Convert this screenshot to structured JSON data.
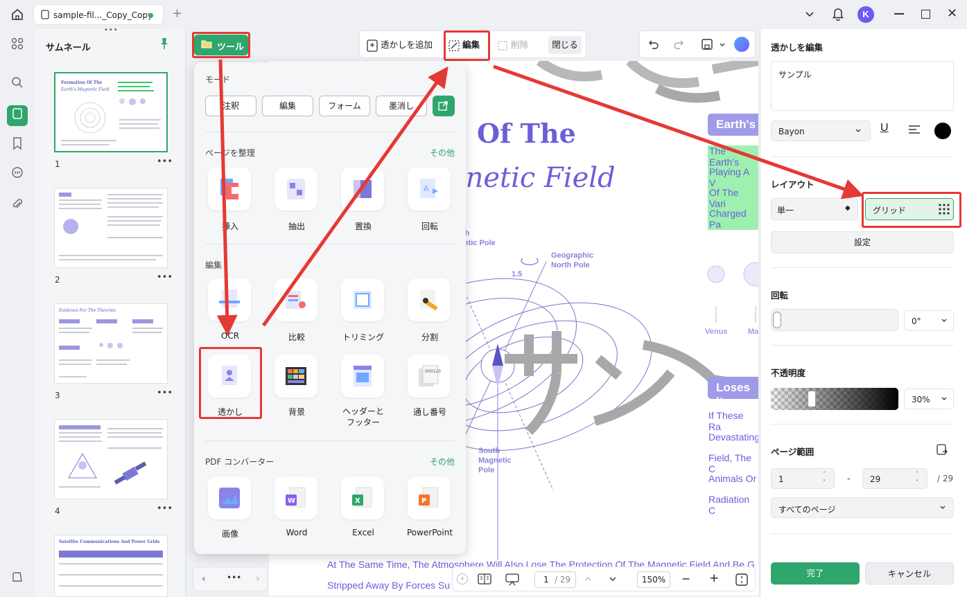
{
  "titlebar": {
    "tab_label": "sample-fil..._Copy_Copy",
    "avatar_letter": "K"
  },
  "thumbnails": {
    "title": "サムネール",
    "pages": [
      {
        "num": "1",
        "title": "Formation Of The",
        "subtitle": "Earth's Magnetic Field"
      },
      {
        "num": "2"
      },
      {
        "num": "3",
        "title": "Evidence For The Theories"
      },
      {
        "num": "4"
      },
      {
        "num": "",
        "title": "Satellite Communications And Power Grids"
      }
    ]
  },
  "toolbar": {
    "tool_label": "ツール",
    "add_watermark": "透かしを追加",
    "edit": "編集",
    "delete": "削除",
    "close": "閉じる"
  },
  "tool_menu": {
    "mode_title": "モード",
    "modes": [
      "注釈",
      "編集",
      "フォーム",
      "墨消し"
    ],
    "organize_title": "ページを整理",
    "more": "その他",
    "organize_items": [
      "挿入",
      "抽出",
      "置換",
      "回転"
    ],
    "edit_title": "編集",
    "edit_items": [
      "OCR",
      "比較",
      "トリミング",
      "分割"
    ],
    "edit_items2": [
      "透かし",
      "背景",
      "ヘッダーと\nフッター",
      "通し番号"
    ],
    "header_footer_line1": "ヘッダーと",
    "header_footer_line2": "フッター",
    "converter_title": "PDF コンバーター",
    "converter_items": [
      "画像",
      "Word",
      "Excel",
      "PowerPoint"
    ]
  },
  "page_content": {
    "title_line1": "Of The",
    "title_line2": "gnetic Field",
    "earth_badge": "Earth's",
    "hl_lines": [
      "The Earth's",
      "Playing A V",
      "Of The Vari",
      "Charged Pa"
    ],
    "loses_badge": "Loses It",
    "purple_lines": [
      "If These Ra",
      "Devastating",
      "Field, The C",
      "Animals Or",
      "Radiation C"
    ],
    "north_label": "orth\ngnetic Pole",
    "north_l1": "orth",
    "north_l2": "gnetic Pole",
    "geo_l1": "Geographic",
    "geo_l2": "North Pole",
    "angle": "1.5",
    "south_l1": "South",
    "south_l2": "Magnetic",
    "south_l3": "Pole",
    "venus": "Venus",
    "ma": "Ma",
    "bottom_line1": "At The Same Time, The Atmosphere Will Also Lose The Protection Of The Magnetic Field And Be G",
    "bottom_line2": "Stripped Away By Forces Su",
    "watermark_text": "サン"
  },
  "bottom_bar": {
    "page_current": "1",
    "page_total": "/ 29",
    "zoom": "150%"
  },
  "right_panel": {
    "title": "透かしを編集",
    "text_value": "サンプル",
    "font": "Bayon",
    "layout_title": "レイアウト",
    "layout_single": "単一",
    "layout_grid": "グリッド",
    "settings": "設定",
    "rotation_title": "回転",
    "rotation_value": "0°",
    "opacity_title": "不透明度",
    "opacity_value": "30%",
    "range_title": "ページ範囲",
    "range_from": "1",
    "range_dash": "-",
    "range_to": "29",
    "range_total": "/ 29",
    "range_option": "すべてのページ",
    "done": "完了",
    "cancel": "キャンセル",
    "accent_color": "#2fa66b"
  }
}
